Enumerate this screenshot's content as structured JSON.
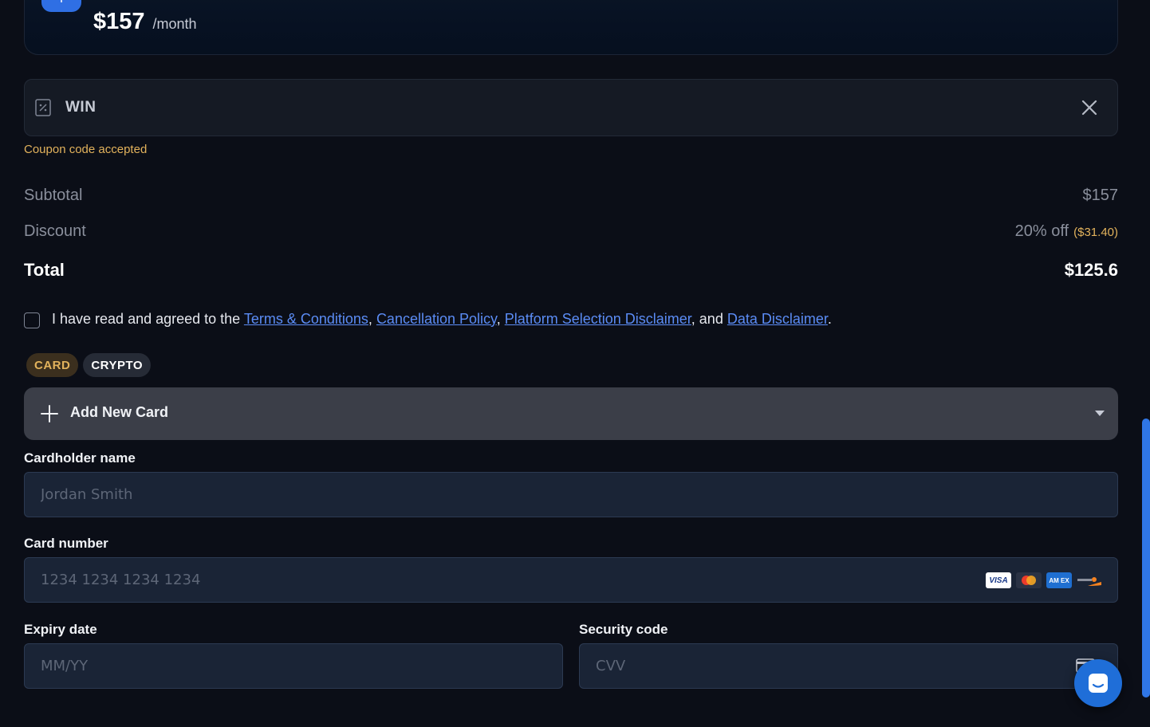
{
  "plan": {
    "price": "$157",
    "period": "/month"
  },
  "coupon": {
    "code": "WIN",
    "message": "Coupon code accepted"
  },
  "summary": {
    "subtotal_label": "Subtotal",
    "subtotal_value": "$157",
    "discount_label": "Discount",
    "discount_value": "20% off",
    "discount_amount": "($31.40)",
    "total_label": "Total",
    "total_value": "$125.6"
  },
  "agreement": {
    "prefix": "I have read and agreed to the ",
    "terms": "Terms & Conditions",
    "sep1": ", ",
    "cancellation": "Cancellation Policy",
    "sep2": ", ",
    "platform": "Platform Selection Disclaimer",
    "sep3": ", and ",
    "data": "Data Disclaimer",
    "suffix": "."
  },
  "payment_tabs": {
    "card": "CARD",
    "crypto": "CRYPTO"
  },
  "card_select": {
    "label": "Add New Card"
  },
  "form": {
    "cardholder_label": "Cardholder name",
    "cardholder_placeholder": "Jordan Smith",
    "card_number_label": "Card number",
    "card_number_placeholder": "1234 1234 1234 1234",
    "expiry_label": "Expiry date",
    "expiry_placeholder": "MM/YY",
    "security_label": "Security code",
    "security_placeholder": "CVV"
  },
  "card_brands": {
    "visa": "VISA",
    "amex": "AM EX"
  },
  "colors": {
    "background": "#0b0e17",
    "accent_gold": "#e2b25c",
    "link_blue": "#5b8cf5",
    "primary_blue": "#1f6ed8"
  }
}
